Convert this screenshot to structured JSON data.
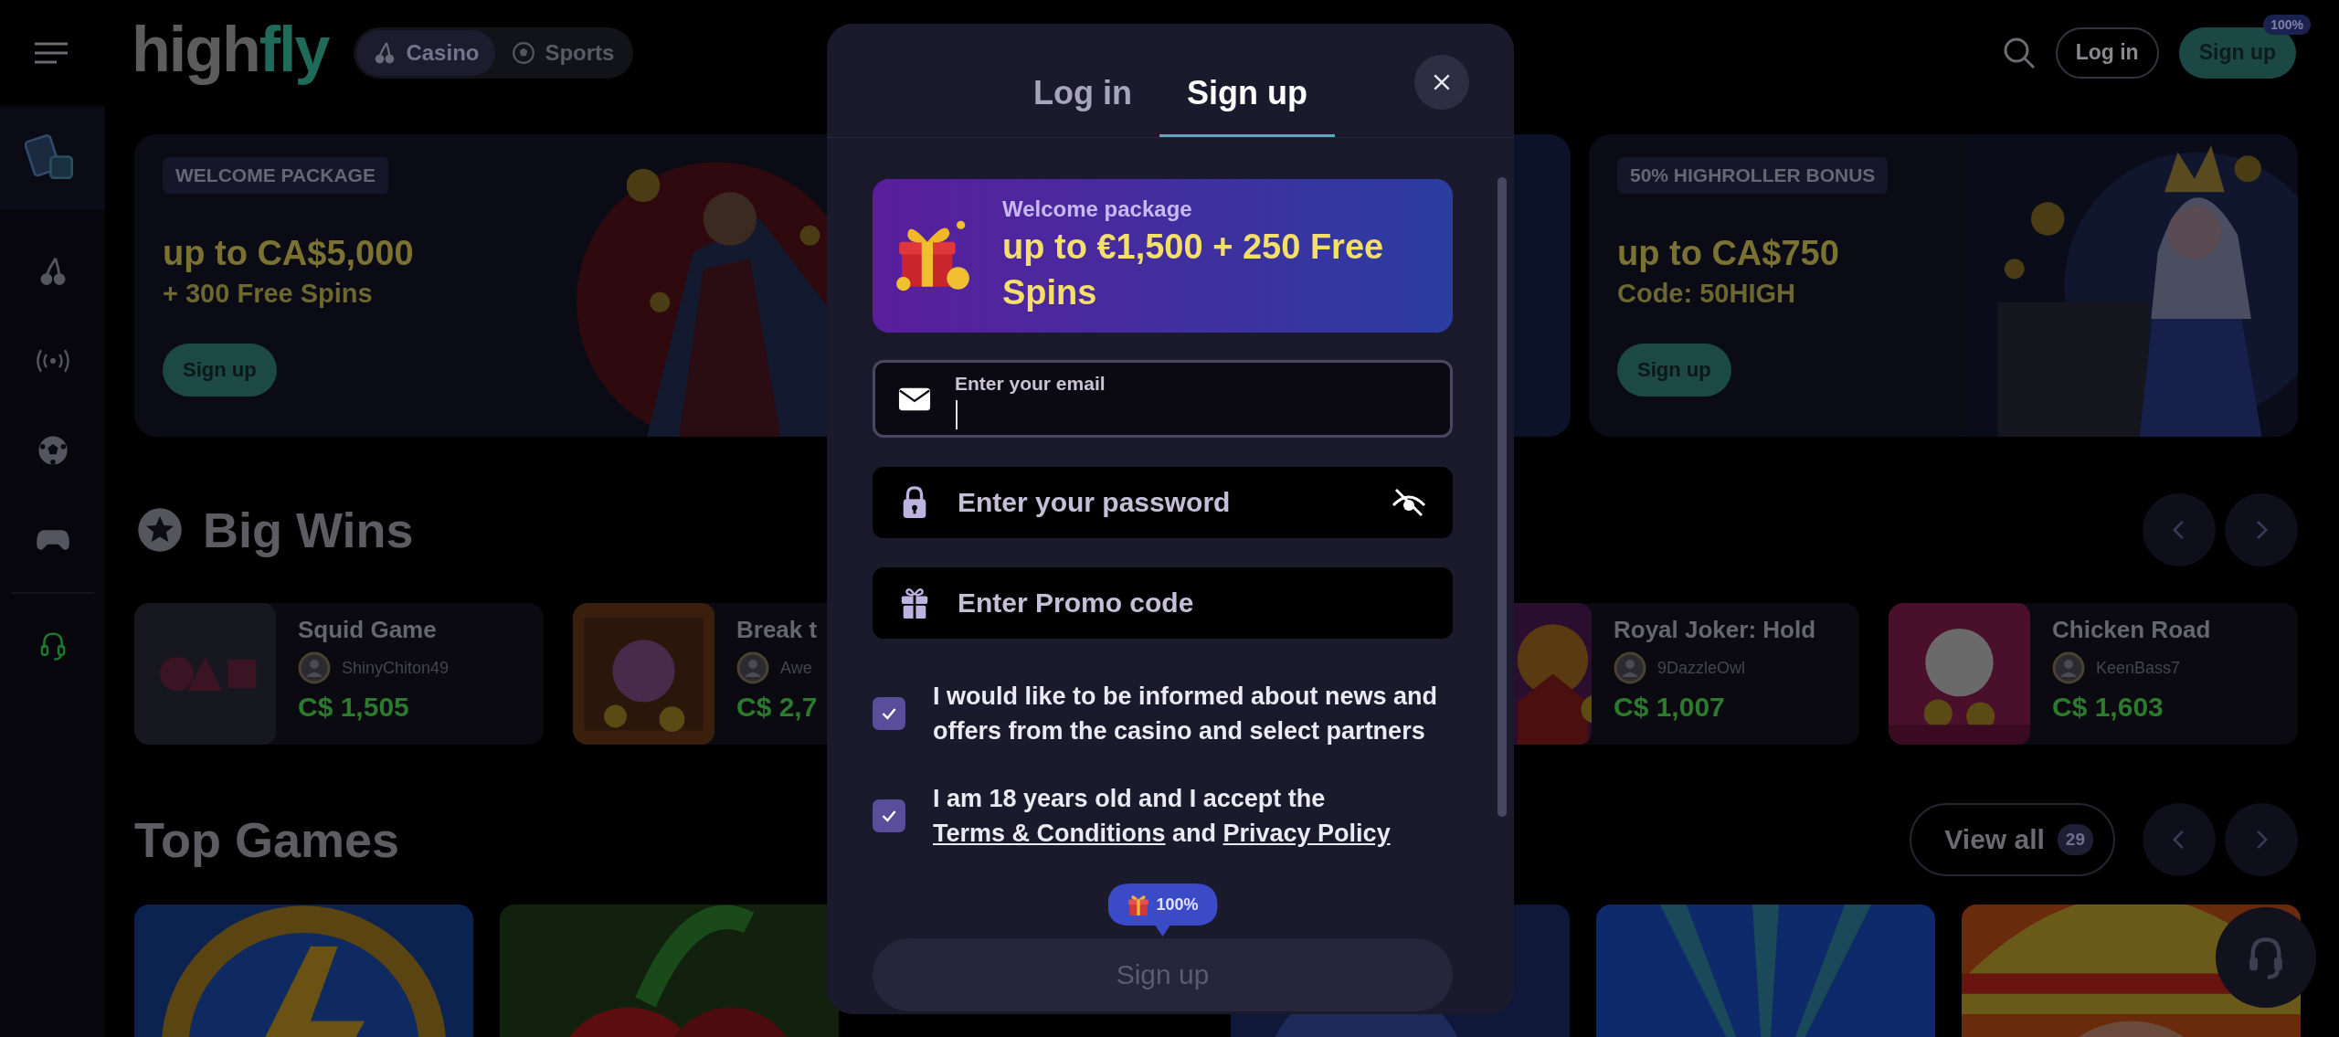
{
  "header": {
    "logo": [
      "high",
      "fly"
    ],
    "nav": [
      {
        "label": "Casino",
        "selected": true
      },
      {
        "label": "Sports",
        "selected": false
      }
    ],
    "login": "Log in",
    "signup": "Sign up",
    "signup_badge": "100%"
  },
  "banners": [
    {
      "kind": "promo",
      "tag": "WELCOME PACKAGE",
      "title": "up to CA$5,000",
      "subtitle": "+ 300 Free Spins",
      "button": "Sign up"
    },
    {
      "kind": "picture"
    },
    {
      "kind": "promo",
      "tag": "50% HIGHROLLER BONUS",
      "title": "up to CA$750",
      "subtitle": "Code: 50HIGH",
      "button": "Sign up"
    }
  ],
  "big_wins": {
    "title": "Big Wins",
    "cards": [
      {
        "game": "Squid Game",
        "player": "ShinyChiton49",
        "amount": "C$ 1,505"
      },
      {
        "game": "Break t",
        "player": "Awe",
        "amount": "C$ 2,7"
      },
      {
        "game": "Royal Joker: Hold",
        "player": "9DazzleOwl",
        "amount": "C$ 1,007"
      },
      {
        "game": "Chicken Road",
        "player": "KeenBass7",
        "amount": "C$ 1,603"
      }
    ]
  },
  "top_games": {
    "title": "Top Games",
    "view_all": "View all",
    "count": "29",
    "tiles": [
      {
        "kind": "picture"
      },
      {
        "kind": "picture"
      },
      {
        "kind": "picture"
      },
      {
        "kind": "picture"
      },
      {
        "kind": "picture"
      }
    ]
  },
  "modal": {
    "tabs": [
      {
        "label": "Log in",
        "selected": false
      },
      {
        "label": "Sign up",
        "selected": true
      }
    ],
    "promo": {
      "label": "Welcome package",
      "title": "up to €1,500 + 250 Free Spins"
    },
    "fields": [
      {
        "kind": "email",
        "label": "Enter your email",
        "focused": true
      },
      {
        "kind": "password",
        "placeholder": "Enter your password",
        "focused": false
      },
      {
        "kind": "promo",
        "placeholder": "Enter Promo code",
        "focused": false
      }
    ],
    "consents": [
      {
        "checked": true,
        "parts": [
          {
            "kind": "text",
            "text": "I would like to be informed about news and offers from the casino and select partners"
          }
        ]
      },
      {
        "checked": true,
        "parts": [
          {
            "kind": "text",
            "text": "I am 18 years old and I accept the "
          },
          {
            "kind": "link",
            "text": "Terms & Conditions"
          },
          {
            "kind": "text",
            "text": " and "
          },
          {
            "kind": "link",
            "text": "Privacy Policy"
          }
        ]
      }
    ],
    "bonus_badge": "100%",
    "submit": {
      "label": "Sign up",
      "disabled": true
    }
  }
}
